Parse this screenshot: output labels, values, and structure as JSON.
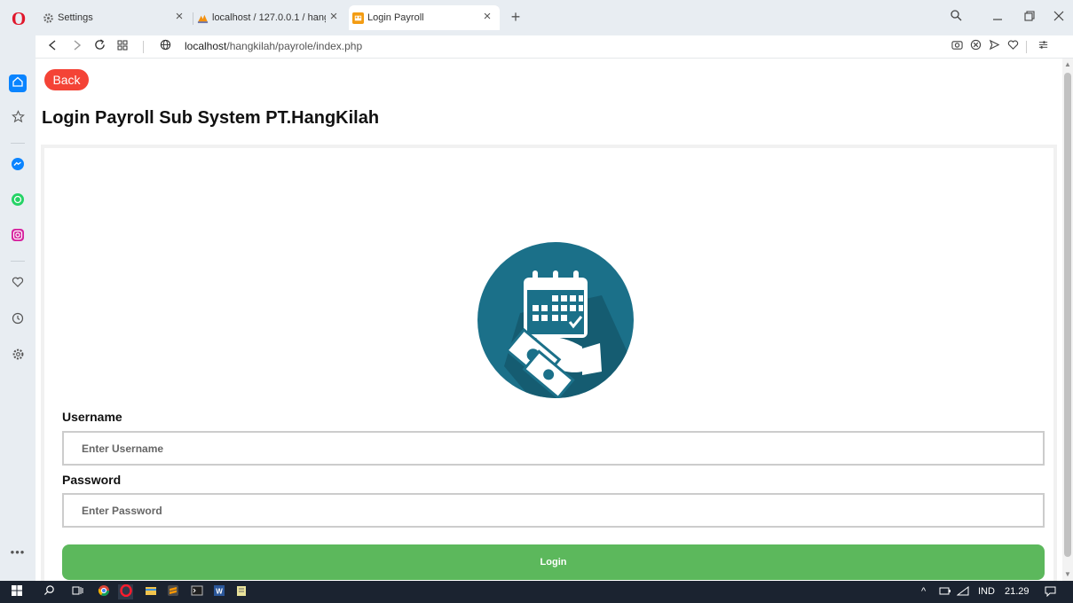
{
  "browser": {
    "tabs": [
      {
        "label": "Settings",
        "icon": "gear-icon"
      },
      {
        "label": "localhost / 127.0.0.1 / hang",
        "icon": "phpmyadmin-icon"
      },
      {
        "label": "Login Payroll",
        "icon": "payroll-favicon"
      }
    ],
    "close_glyph": "×",
    "newtab_glyph": "+",
    "logo_letter": "O",
    "url_host": "localhost",
    "url_path": "/hangkilah/payrole/index.php"
  },
  "page": {
    "back_label": "Back",
    "title": "Login Payroll Sub System PT.HangKilah",
    "username_label": "Username",
    "username_placeholder": "Enter Username",
    "password_label": "Password",
    "password_placeholder": "Enter Password",
    "login_label": "Login"
  },
  "taskbar": {
    "language": "IND",
    "time": "21.29"
  },
  "colors": {
    "back_button": "#f44336",
    "login_button": "#5cb85c",
    "logo_circle": "#1b7089"
  }
}
